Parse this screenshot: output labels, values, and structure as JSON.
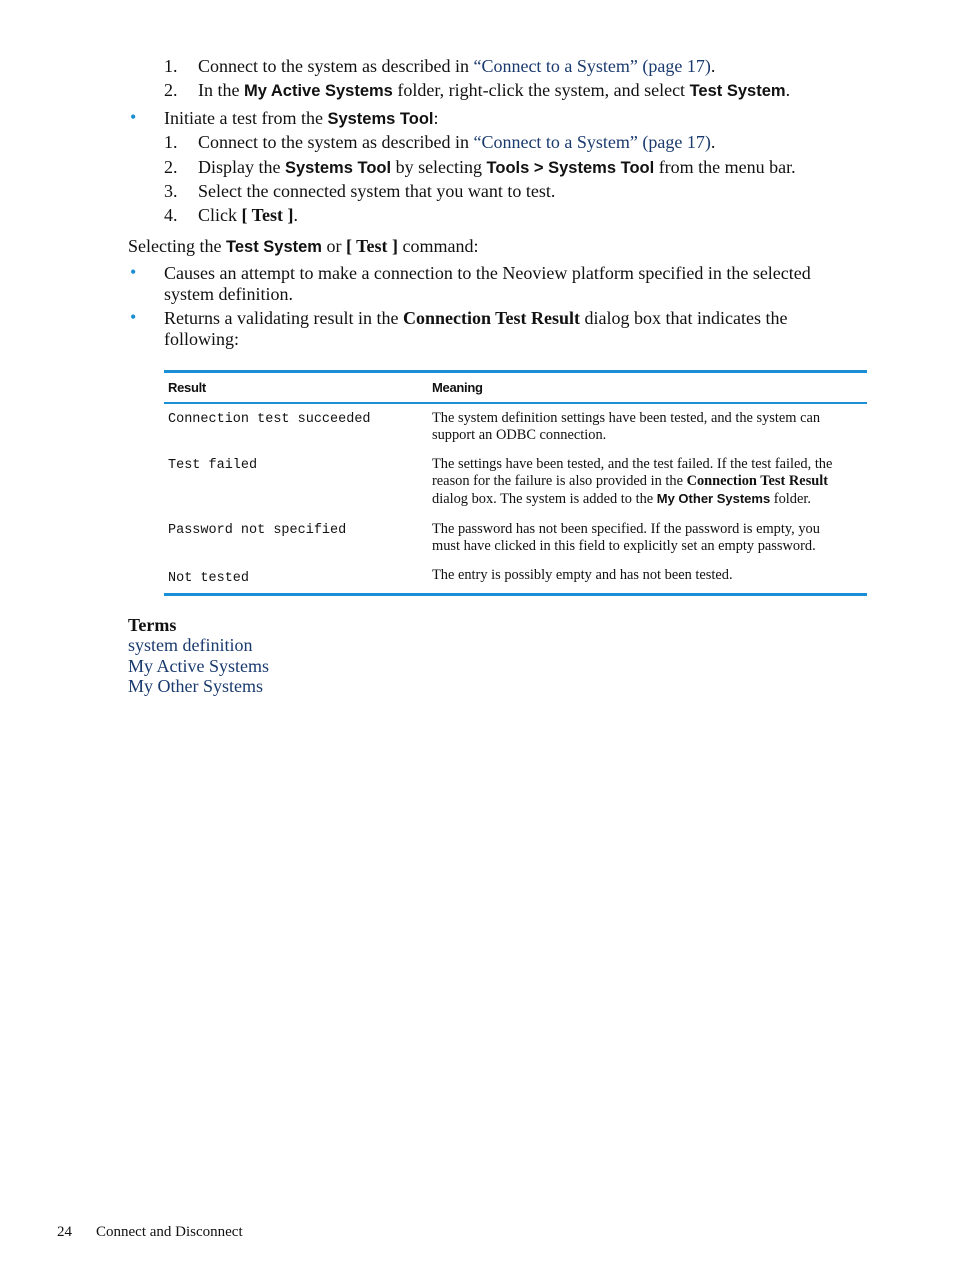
{
  "list_a": [
    {
      "num": "1.",
      "pre": "Connect to the system as described in ",
      "link": "“Connect to a System” (page 17)",
      "post": "."
    },
    {
      "num": "2.",
      "pre": "In the ",
      "b1": "My Active Systems",
      "mid": " folder, right-click the system, and select ",
      "b2": "Test System",
      "post": "."
    }
  ],
  "bullet_b": {
    "pre": "Initiate a test from the ",
    "bold": "Systems Tool",
    "post": ":"
  },
  "list_b": [
    {
      "num": "1.",
      "pre": "Connect to the system as described in ",
      "link": "“Connect to a System” (page 17)",
      "post": "."
    },
    {
      "num": "2.",
      "pre": "Display the ",
      "b1": "Systems Tool",
      "mid": " by selecting ",
      "b2": "Tools > Systems Tool",
      "post": " from the menu bar."
    },
    {
      "num": "3.",
      "text": "Select the connected system that you want to test."
    },
    {
      "num": "4.",
      "pre": "Click ",
      "bold": "[ Test ]",
      "post": "."
    }
  ],
  "selecting": {
    "pre": "Selecting the ",
    "b1": "Test System",
    "mid": " or ",
    "b2": "[ Test ]",
    "post": " command:"
  },
  "bullets_c": [
    {
      "line1": "Causes an attempt to make a connection to the Neoview platform specified in the selected",
      "line2": "system definition."
    },
    {
      "pre": "Returns a validating result in the ",
      "bold": "Connection Test Result",
      "post": " dialog box that indicates the",
      "line2": "following:"
    }
  ],
  "table": {
    "headers": [
      "Result",
      "Meaning"
    ],
    "rows": [
      {
        "result": "Connection test succeeded",
        "meaning_lines": [
          "The system definition settings have been tested, and the system can",
          "support an ODBC connection."
        ]
      },
      {
        "result": "Test failed",
        "m1": "The settings have been tested, and the test failed. If the test failed, the",
        "m2_pre": "reason for the failure is also provided in the ",
        "m2_bold": "Connection Test Result",
        "m3_pre": "dialog box. The system is added to the ",
        "m3_bold": "My Other Systems",
        "m3_post": " folder."
      },
      {
        "result": "Password not specified",
        "meaning_lines": [
          "The password has not been specified. If the password is empty, you",
          "must have clicked in this field to explicitly set an empty password."
        ]
      },
      {
        "result": "Not tested",
        "meaning_lines": [
          "The entry is possibly empty and has not been tested."
        ]
      }
    ]
  },
  "terms": {
    "heading": "Terms",
    "links": [
      "system definition",
      "My Active Systems",
      "My Other Systems"
    ]
  },
  "footer": {
    "page_number": "24",
    "section": "Connect and Disconnect"
  },
  "colors": {
    "accent": "#1a8fd6",
    "link": "#1a3a6e"
  }
}
